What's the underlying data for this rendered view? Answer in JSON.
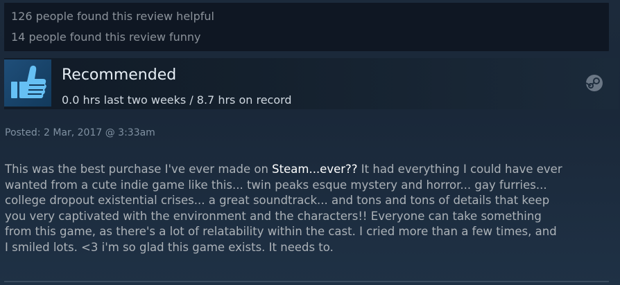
{
  "helpful": {
    "helpful_text": "126 people found this review helpful",
    "funny_text": "14 people found this review funny"
  },
  "recommendation": {
    "icon": "thumbs-up-icon",
    "title": "Recommended",
    "hours": "0.0 hrs last two weeks / 8.7 hrs on record",
    "platform_icon": "steam-icon"
  },
  "posted": "Posted: 2 Mar, 2017 @ 3:33am",
  "review": {
    "line1_before": "This was the best purchase I've ever made on ",
    "line1_highlight": "Steam...ever??",
    "line1_after": " It had everything I could have ever",
    "line2": "wanted from a cute indie game like this... twin peaks esque mystery and horror... gay furries...",
    "line3": "college dropout existential crises... a great soundtrack... and tons and tons of details that keep",
    "line4": "you very captivated with the environment and the characters!! Everyone can take something",
    "line5": "from this game, as there's a lot of relatability within the cast. I cried more than a few times, and",
    "line6": "I smiled lots. <3 i'm so glad this game exists. It needs to."
  },
  "colors": {
    "background": "#1b2838",
    "thumb_bg": "#1f4e79",
    "thumb_fg": "#66c0f4",
    "text_muted": "#8b929a",
    "text_body": "#acb2b8"
  }
}
